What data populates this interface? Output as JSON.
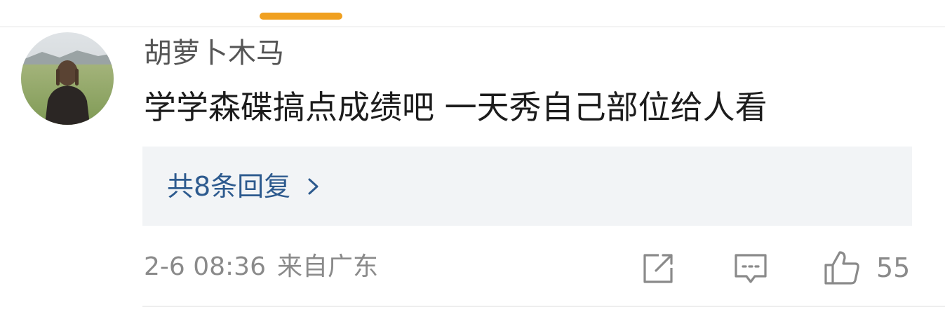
{
  "comment": {
    "username": "胡萝卜木马",
    "text": "学学森碟搞点成绩吧 一天秀自己部位给人看",
    "replies_label": "共8条回复",
    "timestamp": "2-6 08:36",
    "location": "来自广东",
    "like_count": "55"
  },
  "icons": {
    "avatar": "avatar-photo",
    "replies_chevron": "chevron-right-icon",
    "share": "share-icon",
    "comment": "comment-icon",
    "like": "thumbs-up-icon"
  },
  "colors": {
    "tab_indicator": "#f0a020",
    "replies_link": "#2d5a8e",
    "replies_background": "#f2f4f6",
    "meta_text": "#8a8a8a"
  }
}
